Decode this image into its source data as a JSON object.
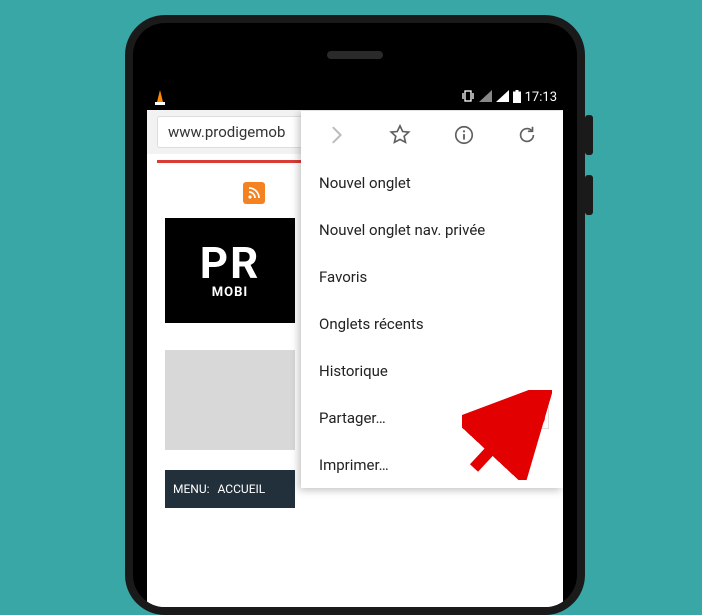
{
  "statusbar": {
    "time": "17:13"
  },
  "url": "www.prodigemob",
  "page": {
    "logo_top": "PR",
    "logo_sub": "MOBI",
    "menu_label": "MENU:",
    "menu_item": "ACCUEIL"
  },
  "dropdown": {
    "items": [
      "Nouvel onglet",
      "Nouvel onglet nav. privée",
      "Favoris",
      "Onglets récents",
      "Historique",
      "Partager…",
      "Imprimer…"
    ]
  }
}
